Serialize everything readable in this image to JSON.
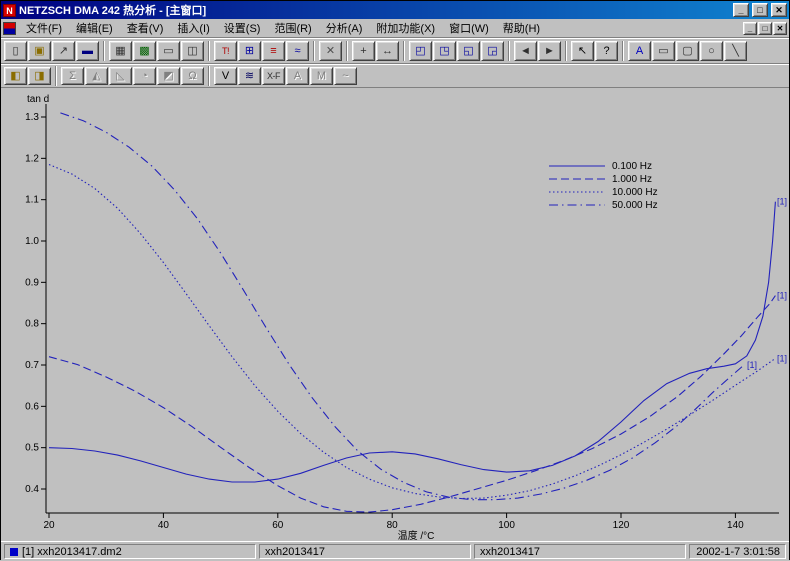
{
  "window": {
    "title": "NETZSCH DMA 242 热分析 - [主窗口]",
    "icon_letter": "N",
    "controls": {
      "minimize": "_",
      "maximize": "□",
      "close": "✕"
    },
    "mdi_controls": {
      "minimize": "_",
      "restore": "□",
      "close": "✕"
    }
  },
  "menu": {
    "items": [
      "文件(F)",
      "编辑(E)",
      "查看(V)",
      "插入(I)",
      "设置(S)",
      "范围(R)",
      "分析(A)",
      "附加功能(X)",
      "窗口(W)",
      "帮助(H)"
    ]
  },
  "toolbar_row1": [
    {
      "name": "new-button",
      "glyph": "▯",
      "color": "#303030"
    },
    {
      "name": "open-button",
      "glyph": "▣",
      "color": "#8a6d00"
    },
    {
      "name": "import-button",
      "glyph": "↗",
      "color": "#303030"
    },
    {
      "name": "save-button",
      "glyph": "▬",
      "color": "#000080"
    },
    "|",
    {
      "name": "copy-button",
      "glyph": "▦",
      "color": "#303030"
    },
    {
      "name": "report-button",
      "glyph": "▩",
      "color": "#006000"
    },
    {
      "name": "print-button",
      "glyph": "▭",
      "color": "#303030"
    },
    {
      "name": "preview-button",
      "glyph": "◫",
      "color": "#303030"
    },
    "|",
    {
      "name": "insert-text-button",
      "glyph": "T!",
      "color": "#b00000"
    },
    {
      "name": "axis-settings-button",
      "glyph": "⊞",
      "color": "#0000a0"
    },
    {
      "name": "data-table-button",
      "glyph": "≡",
      "color": "#b00000"
    },
    {
      "name": "curve-settings-button",
      "glyph": "≈",
      "color": "#0000a0"
    },
    "|",
    {
      "name": "delete-button",
      "glyph": "✕",
      "color": "#505050"
    },
    "|",
    {
      "name": "crosshair-button",
      "glyph": "+",
      "color": "#303030"
    },
    {
      "name": "fit-range-button",
      "glyph": "↔",
      "color": "#303030"
    },
    "|",
    {
      "name": "zoom-x-button",
      "glyph": "◰",
      "color": "#0000a0"
    },
    {
      "name": "zoom-y-button",
      "glyph": "◳",
      "color": "#0000a0"
    },
    {
      "name": "zoom-window-button",
      "glyph": "◱",
      "color": "#0000a0"
    },
    {
      "name": "zoom-reset-button",
      "glyph": "◲",
      "color": "#0000a0"
    },
    "|",
    {
      "name": "shift-left-button",
      "glyph": "◄",
      "color": "#303030"
    },
    {
      "name": "shift-right-button",
      "glyph": "►",
      "color": "#303030"
    },
    "|",
    {
      "name": "select-arrow-button",
      "glyph": "↖",
      "color": "#000000"
    },
    {
      "name": "context-help-button",
      "glyph": "?",
      "color": "#000000"
    },
    "|",
    {
      "name": "text-tool-button",
      "glyph": "A",
      "color": "#0000c0"
    },
    {
      "name": "rect-tool-button",
      "glyph": "▭",
      "color": "#303030"
    },
    {
      "name": "roundrect-tool-button",
      "glyph": "▢",
      "color": "#303030"
    },
    {
      "name": "ellipse-tool-button",
      "glyph": "○",
      "color": "#303030"
    },
    {
      "name": "line-tool-button",
      "glyph": "╲",
      "color": "#303030"
    }
  ],
  "toolbar_row2": [
    {
      "name": "segment-prev-button",
      "glyph": "◧",
      "color": "#8a6d00"
    },
    {
      "name": "segment-next-button",
      "glyph": "◨",
      "color": "#8a6d00"
    },
    "|",
    {
      "name": "analysis-sum-button",
      "glyph": "Σ",
      "color": "#808080",
      "enabled": false
    },
    {
      "name": "analysis-peak-button",
      "glyph": "◭",
      "color": "#808080",
      "enabled": false
    },
    {
      "name": "analysis-onset-button",
      "glyph": "◺",
      "color": "#808080",
      "enabled": false
    },
    {
      "name": "analysis-area-button",
      "glyph": "◔",
      "color": "#808080",
      "enabled": false
    },
    {
      "name": "analysis-glass-button",
      "glyph": "◩",
      "color": "#808080",
      "enabled": false
    },
    {
      "name": "analysis-omega-button",
      "glyph": "Ω",
      "color": "#808080",
      "enabled": false
    },
    "|",
    {
      "name": "value-marker-button",
      "glyph": "V",
      "color": "#000000"
    },
    {
      "name": "curve-list-button",
      "glyph": "≋",
      "color": "#000060"
    },
    {
      "name": "x-f-button",
      "glyph": "X-F",
      "color": "#303030"
    },
    {
      "name": "a-marker-button",
      "glyph": "A",
      "color": "#909090",
      "enabled": false
    },
    {
      "name": "m-marker-button",
      "glyph": "M",
      "color": "#909090",
      "enabled": false
    },
    {
      "name": "wave-button",
      "glyph": "~",
      "color": "#909090",
      "enabled": false
    }
  ],
  "statusbar": {
    "file": "[1] xxh2013417.dm2",
    "sample1": "xxh2013417",
    "sample2": "xxh2013417",
    "datetime": "2002-1-7 3:01:58"
  },
  "chart_data": {
    "type": "line",
    "title": "",
    "xlabel": "温度 /°C",
    "ylabel": "tan d",
    "x_ticks": [
      20,
      40,
      60,
      80,
      100,
      120,
      140
    ],
    "y_ticks": [
      0.4,
      0.5,
      0.6,
      0.7,
      0.8,
      0.9,
      1.0,
      1.1,
      1.2,
      1.3
    ],
    "xlim": [
      18,
      150
    ],
    "ylim": [
      0.34,
      1.35
    ],
    "line_color": "#2222bb",
    "curve_label": "[1]",
    "legend_position": "upper-right",
    "series": [
      {
        "name": "0.100 Hz",
        "line_style": "solid",
        "points": [
          [
            20,
            0.5
          ],
          [
            24,
            0.498
          ],
          [
            28,
            0.492
          ],
          [
            32,
            0.482
          ],
          [
            36,
            0.468
          ],
          [
            40,
            0.452
          ],
          [
            44,
            0.436
          ],
          [
            48,
            0.424
          ],
          [
            52,
            0.417
          ],
          [
            56,
            0.417
          ],
          [
            60,
            0.424
          ],
          [
            64,
            0.438
          ],
          [
            68,
            0.457
          ],
          [
            72,
            0.475
          ],
          [
            76,
            0.487
          ],
          [
            80,
            0.49
          ],
          [
            84,
            0.485
          ],
          [
            88,
            0.473
          ],
          [
            92,
            0.459
          ],
          [
            96,
            0.447
          ],
          [
            100,
            0.441
          ],
          [
            104,
            0.444
          ],
          [
            108,
            0.457
          ],
          [
            112,
            0.48
          ],
          [
            116,
            0.515
          ],
          [
            120,
            0.562
          ],
          [
            124,
            0.614
          ],
          [
            128,
            0.655
          ],
          [
            132,
            0.68
          ],
          [
            135,
            0.691
          ],
          [
            138,
            0.697
          ],
          [
            140,
            0.703
          ],
          [
            142,
            0.722
          ],
          [
            143.5,
            0.76
          ],
          [
            144.8,
            0.818
          ],
          [
            145.8,
            0.9
          ],
          [
            146.5,
            1.0
          ],
          [
            147,
            1.095
          ]
        ]
      },
      {
        "name": "1.000 Hz",
        "line_style": "dash",
        "points": [
          [
            20,
            0.72
          ],
          [
            25,
            0.701
          ],
          [
            30,
            0.671
          ],
          [
            35,
            0.637
          ],
          [
            40,
            0.597
          ],
          [
            45,
            0.551
          ],
          [
            50,
            0.501
          ],
          [
            55,
            0.452
          ],
          [
            60,
            0.408
          ],
          [
            64,
            0.378
          ],
          [
            68,
            0.357
          ],
          [
            72,
            0.346
          ],
          [
            76,
            0.344
          ],
          [
            80,
            0.35
          ],
          [
            85,
            0.363
          ],
          [
            90,
            0.381
          ],
          [
            95,
            0.401
          ],
          [
            100,
            0.421
          ],
          [
            105,
            0.444
          ],
          [
            110,
            0.469
          ],
          [
            115,
            0.498
          ],
          [
            120,
            0.533
          ],
          [
            125,
            0.575
          ],
          [
            130,
            0.625
          ],
          [
            134,
            0.673
          ],
          [
            138,
            0.727
          ],
          [
            141,
            0.77
          ],
          [
            144,
            0.818
          ],
          [
            146,
            0.848
          ],
          [
            147,
            0.868
          ]
        ]
      },
      {
        "name": "10.000 Hz",
        "line_style": "dot",
        "points": [
          [
            20,
            1.185
          ],
          [
            24,
            1.162
          ],
          [
            28,
            1.127
          ],
          [
            32,
            1.079
          ],
          [
            36,
            1.018
          ],
          [
            40,
            0.948
          ],
          [
            44,
            0.872
          ],
          [
            48,
            0.795
          ],
          [
            52,
            0.72
          ],
          [
            56,
            0.65
          ],
          [
            60,
            0.588
          ],
          [
            64,
            0.534
          ],
          [
            68,
            0.489
          ],
          [
            72,
            0.452
          ],
          [
            76,
            0.424
          ],
          [
            80,
            0.403
          ],
          [
            84,
            0.389
          ],
          [
            88,
            0.381
          ],
          [
            92,
            0.377
          ],
          [
            96,
            0.378
          ],
          [
            100,
            0.385
          ],
          [
            104,
            0.396
          ],
          [
            108,
            0.412
          ],
          [
            112,
            0.432
          ],
          [
            116,
            0.456
          ],
          [
            120,
            0.483
          ],
          [
            124,
            0.513
          ],
          [
            128,
            0.545
          ],
          [
            132,
            0.579
          ],
          [
            136,
            0.614
          ],
          [
            140,
            0.651
          ],
          [
            144,
            0.687
          ],
          [
            147,
            0.716
          ]
        ]
      },
      {
        "name": "50.000 Hz",
        "line_style": "dashdot",
        "points": [
          [
            22,
            1.31
          ],
          [
            26,
            1.291
          ],
          [
            30,
            1.263
          ],
          [
            34,
            1.227
          ],
          [
            38,
            1.181
          ],
          [
            42,
            1.123
          ],
          [
            46,
            1.053
          ],
          [
            50,
            0.971
          ],
          [
            54,
            0.881
          ],
          [
            58,
            0.789
          ],
          [
            62,
            0.701
          ],
          [
            66,
            0.621
          ],
          [
            70,
            0.551
          ],
          [
            74,
            0.492
          ],
          [
            78,
            0.448
          ],
          [
            82,
            0.416
          ],
          [
            86,
            0.393
          ],
          [
            90,
            0.38
          ],
          [
            94,
            0.374
          ],
          [
            98,
            0.374
          ],
          [
            102,
            0.378
          ],
          [
            106,
            0.388
          ],
          [
            110,
            0.402
          ],
          [
            114,
            0.421
          ],
          [
            118,
            0.445
          ],
          [
            122,
            0.475
          ],
          [
            126,
            0.512
          ],
          [
            130,
            0.555
          ],
          [
            133,
            0.593
          ],
          [
            136,
            0.633
          ],
          [
            139,
            0.67
          ],
          [
            141.5,
            0.7
          ]
        ]
      }
    ]
  }
}
